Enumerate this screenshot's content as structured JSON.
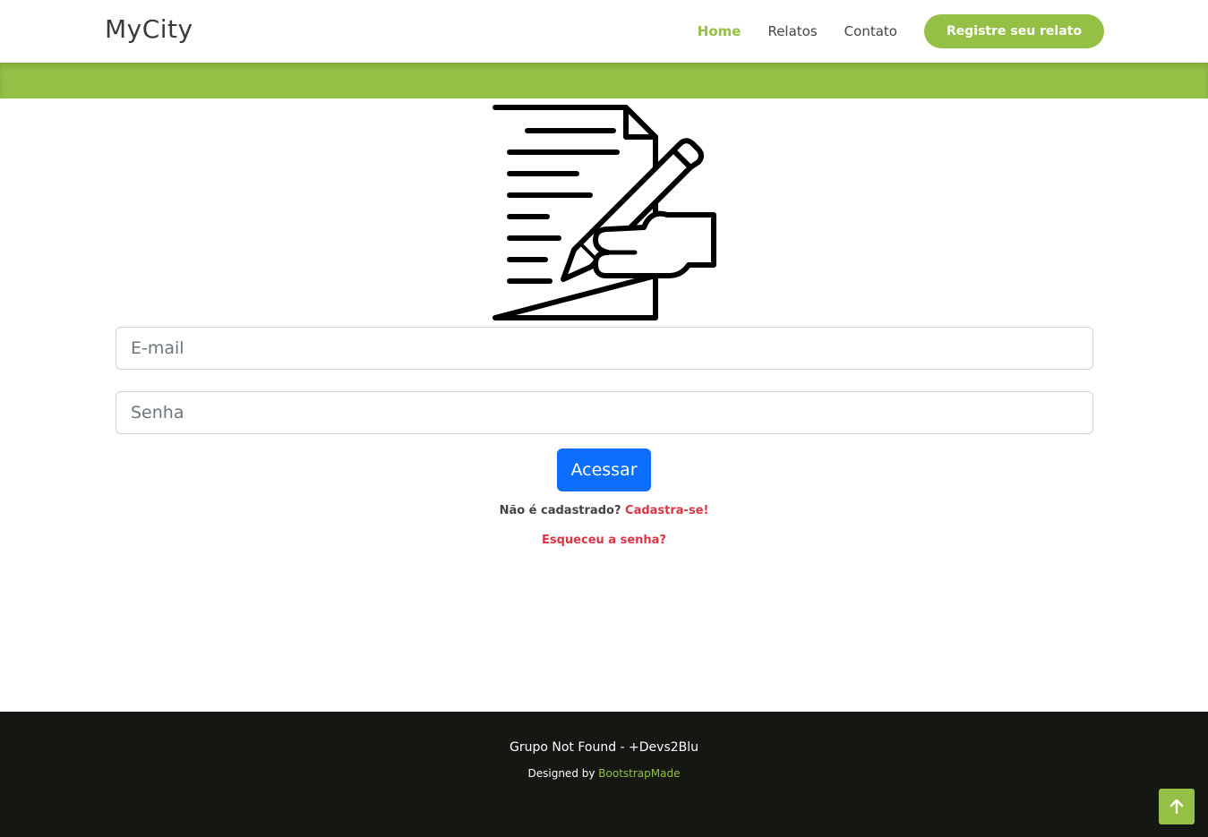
{
  "header": {
    "logo": "MyCity",
    "nav": [
      {
        "label": "Home",
        "active": true
      },
      {
        "label": "Relatos",
        "active": false
      },
      {
        "label": "Contato",
        "active": false
      }
    ],
    "cta_label": "Registre seu relato"
  },
  "login": {
    "email_placeholder": "E-mail",
    "password_placeholder": "Senha",
    "submit_label": "Acessar",
    "register_prompt": "Não é cadastrado?",
    "register_link": "Cadastra-se!",
    "forgot_link": "Esqueceu a senha?"
  },
  "footer": {
    "title": "Grupo Not Found - +Devs2Blu",
    "credit_prefix": "Designed by",
    "credit_link": "BootstrapMade"
  },
  "icons": {
    "main": "document-edit-icon",
    "back_to_top": "arrow-up-icon"
  },
  "colors": {
    "brand_green": "#94c045",
    "primary_button": "#0d6efd",
    "link_red": "#dc3545",
    "footer_bg": "#151713"
  }
}
